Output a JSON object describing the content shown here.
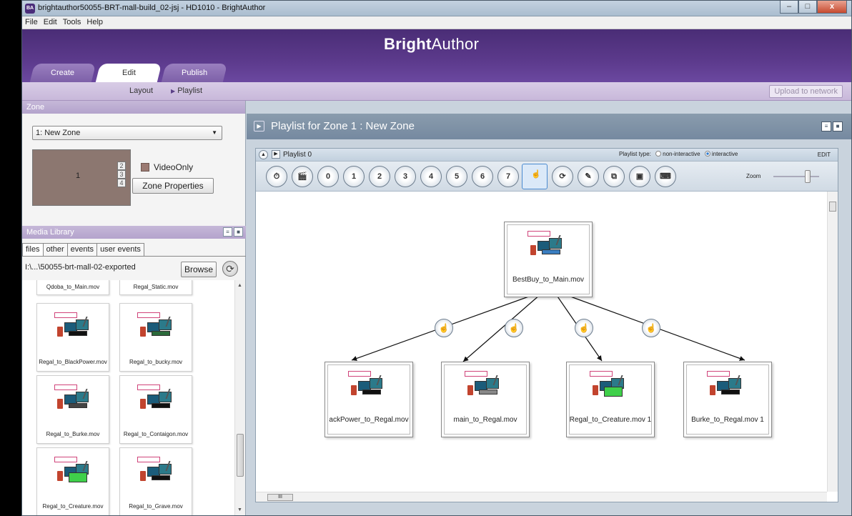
{
  "window": {
    "title": "brightauthor50055-BRT-mall-build_02-jsj - HD1010 - BrightAuthor",
    "app_icon": "BA",
    "minimize": "–",
    "maximize": "□",
    "close": "x"
  },
  "menu": [
    "File",
    "Edit",
    "Tools",
    "Help"
  ],
  "brand": {
    "bold": "Bright",
    "light": "Author"
  },
  "tabs": [
    "Create",
    "Edit",
    "Publish"
  ],
  "subnav": {
    "layout": "Layout",
    "playlist": "Playlist",
    "upload": "Upload to network"
  },
  "zone": {
    "header": "Zone",
    "selected": "1: New Zone",
    "thumb_labels": [
      "1",
      "2",
      "3",
      "4"
    ],
    "video_only": "VideoOnly",
    "properties_button": "Zone Properties",
    "colors": {
      "thumb": "#8c7770"
    }
  },
  "media_library": {
    "header": "Media Library",
    "tabs": [
      "files",
      "other",
      "events",
      "user events"
    ],
    "path": "I:\\...\\50055-brt-mall-02-exported",
    "browse": "Browse",
    "files": [
      "Qdoba_to_Main.mov",
      "Regal_Static.mov",
      "Regal_to_BlackPower.mov",
      "Regal_to_bucky.mov",
      "Regal_to_Burke.mov",
      "Regal_to_Contaigon.mov",
      "Regal_to_Creature.mov",
      "Regal_to_Grave.mov"
    ]
  },
  "playlist": {
    "header": "Playlist for Zone 1 : New Zone",
    "name": "Playlist 0",
    "type_label": "Playlist type:",
    "type_options": [
      "non-interactive",
      "interactive"
    ],
    "type_selected": "interactive",
    "edit": "EDIT",
    "zoom": "Zoom",
    "zoom_level": 0.7,
    "toolbar": [
      "⏱",
      "🎬",
      "0",
      "1",
      "2",
      "3",
      "4",
      "5",
      "6",
      "7",
      "☝",
      "⟳",
      "✎",
      "⧉",
      "▣",
      "⌨"
    ],
    "root_node": "BestBuy_to_Main.mov",
    "child_nodes": [
      "ackPower_to_Regal.mov",
      "main_to_Regal.mov",
      "Regal_to_Creature.mov 1",
      "Burke_to_Regal.mov 1"
    ],
    "event_icon": "☝",
    "scroll_label": "III"
  },
  "colors": {
    "brand_bar": "#4a2d76",
    "subbar": "#c8b8da",
    "playlist_header": "#7589a0",
    "accent": "#2e7bd0"
  }
}
